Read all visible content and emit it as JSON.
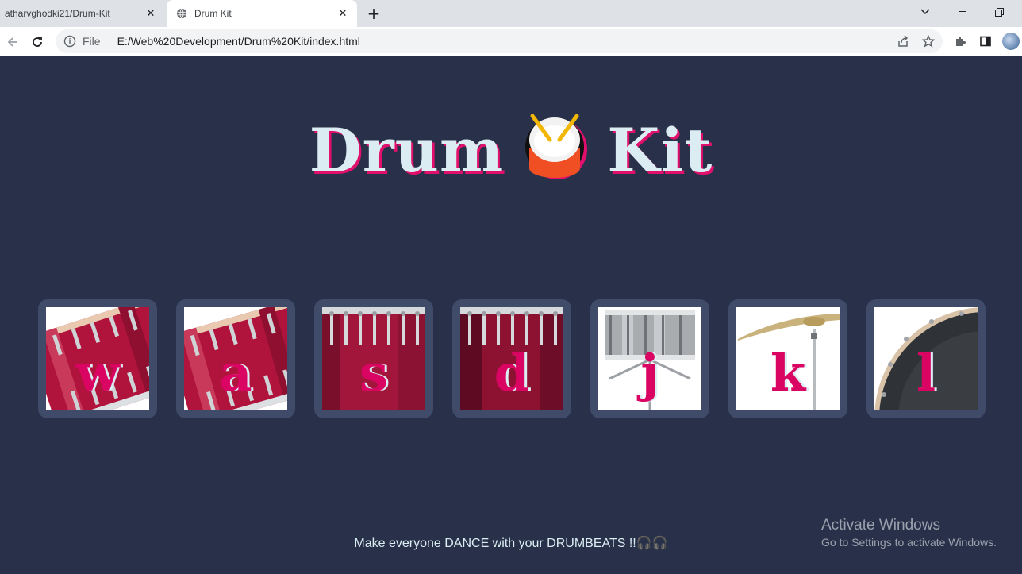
{
  "browser": {
    "tabs": [
      {
        "label": "atharvghodki21/Drum-Kit",
        "active": false
      },
      {
        "label": "Drum Kit",
        "active": true
      }
    ],
    "address": {
      "scheme_label": "File",
      "url": "E:/Web%20Development/Drum%20Kit/index.html"
    }
  },
  "page": {
    "title_left": "Drum",
    "title_right": "Kit",
    "drums": [
      {
        "key": "w",
        "image": "tom-1"
      },
      {
        "key": "a",
        "image": "tom-2"
      },
      {
        "key": "s",
        "image": "tom-3"
      },
      {
        "key": "d",
        "image": "tom-4"
      },
      {
        "key": "j",
        "image": "snare"
      },
      {
        "key": "k",
        "image": "crash"
      },
      {
        "key": "l",
        "image": "kick"
      }
    ],
    "footer": "Make everyone DANCE with your DRUMBEATS !!🎧🎧"
  },
  "os": {
    "activation_title": "Activate Windows",
    "activation_sub": "Go to Settings to activate Windows."
  },
  "colors": {
    "background": "#283149",
    "tile": "#404b69",
    "key": "#da0463",
    "title": "#dbedf3"
  }
}
